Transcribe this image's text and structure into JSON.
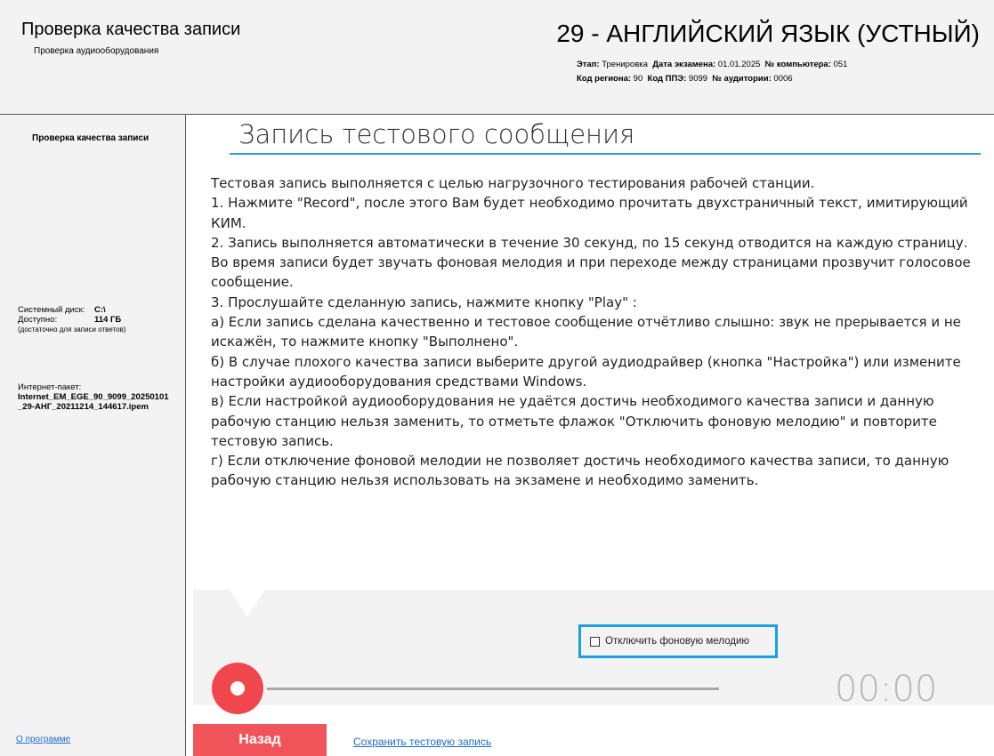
{
  "header": {
    "app_title": "Проверка качества записи",
    "app_subtitle": "Проверка аудиооборудования",
    "exam_title": "29 - АНГЛИЙСКИЙ ЯЗЫК (УСТНЫЙ)",
    "meta": {
      "stage_label": "Этап:",
      "stage_value": "Тренировка",
      "date_label": "Дата экзамена:",
      "date_value": "01.01.2025",
      "computer_label": "№ компьютера:",
      "computer_value": "051",
      "region_label": "Код региона:",
      "region_value": "90",
      "ppe_label": "Код ППЭ:",
      "ppe_value": "9099",
      "room_label": "№ аудитории:",
      "room_value": "0006"
    }
  },
  "sidebar": {
    "title": "Проверка качества записи",
    "disk_label": "Системный диск:",
    "disk_value": "C:\\",
    "free_label": "Доступно:",
    "free_value": "114 ГБ",
    "free_note": "(достаточно для записи ответов)",
    "inet_label": "Интернет-пакет:",
    "inet_value": "Internet_EM_EGE_90_9099_20250101_29-АНГ_20211214_144617.ipem",
    "about_link": "О программе"
  },
  "main": {
    "title": "Запись тестового сообщения",
    "instructions": [
      "Тестовая запись выполняется с целью нагрузочного тестирования рабочей станции.",
      " 1. Нажмите \"Record\", после этого Вам будет необходимо прочитать двухстраничный текст, имитирующий КИМ.",
      " 2. Запись выполняется автоматически в течение 30 секунд, по 15 секунд отводится на каждую страницу. Во время записи будет звучать фоновая мелодия и при переходе между страницами прозвучит голосовое сообщение.",
      " 3. Прослушайте сделанную запись, нажмите кнопку \"Play\" :",
      "    а) Если запись сделана качественно и тестовое сообщение отчётливо слышно: звук не прерывается и не искажён, то нажмите кнопку \"Выполнено\".",
      "    б) В случае плохого качества записи выберите другой аудиодрайвер (кнопка \"Настройка\") или измените настройки аудиооборудования средствами Windows.",
      "    в) Если настройкой аудиооборудования не удаётся достичь необходимого качества записи и данную рабочую станцию нельзя заменить, то отметьте флажок \"Отключить фоновую мелодию\" и повторите тестовую запись.",
      "    г) Если отключение фоновой мелодии не позволяет достичь необходимого качества записи, то данную рабочую станцию нельзя использовать на экзамене и необходимо заменить."
    ],
    "checkbox_label": "Отключить фоновую мелодию",
    "checkbox_checked": false,
    "timer": "00:00",
    "record_color": "#f0474d"
  },
  "footer": {
    "back_button": "Назад",
    "save_link": "Сохранить тестовую запись"
  }
}
